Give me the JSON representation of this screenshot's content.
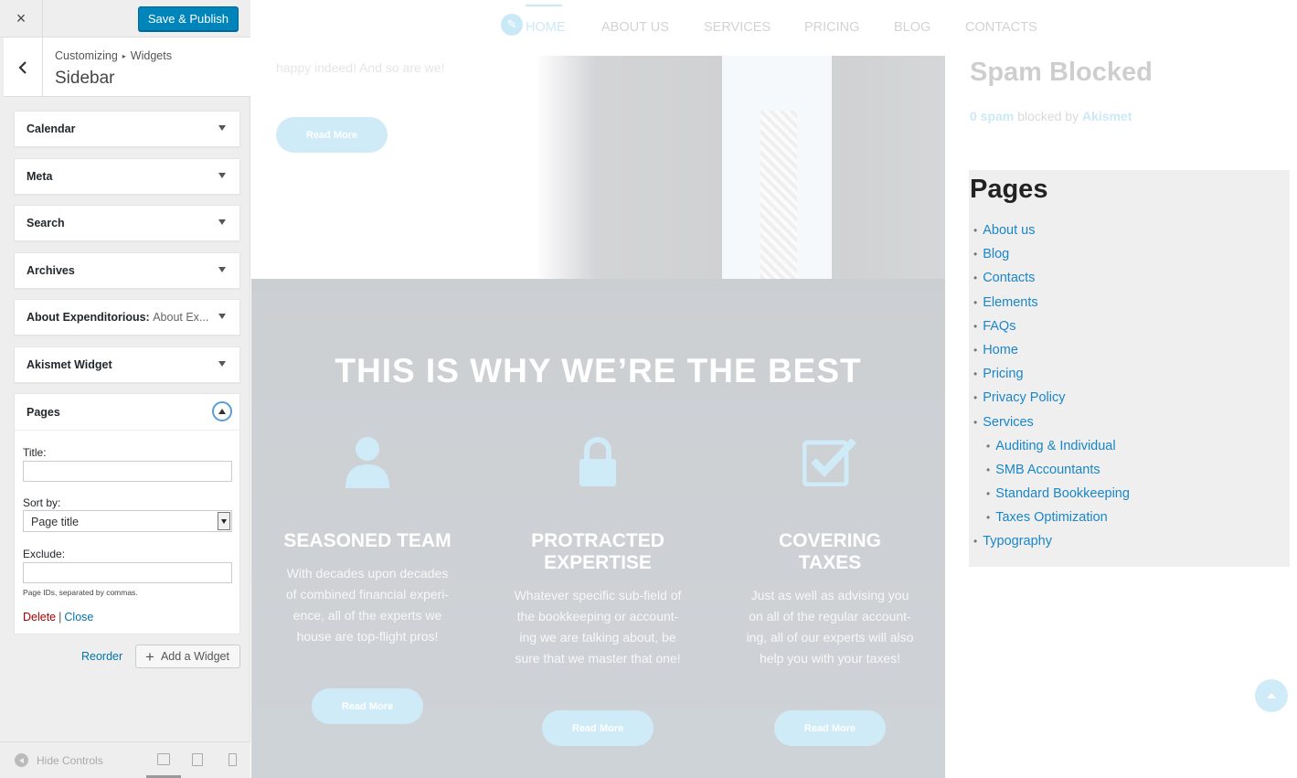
{
  "customizer": {
    "close_glyph": "×",
    "save_label": "Save & Publish",
    "breadcrumb": [
      "Customizing",
      "Widgets"
    ],
    "breadcrumb_sep": "▸",
    "section_title": "Sidebar",
    "widgets": [
      {
        "title": "Calendar",
        "sub": ""
      },
      {
        "title": "Meta",
        "sub": ""
      },
      {
        "title": "Search",
        "sub": ""
      },
      {
        "title": "Archives",
        "sub": ""
      },
      {
        "title": "About Expenditorious:",
        "sub": "About Ex..."
      },
      {
        "title": "Akismet Widget",
        "sub": ""
      }
    ],
    "open_widget": {
      "title": "Pages",
      "title_label": "Title:",
      "title_value": "",
      "sort_label": "Sort by:",
      "sort_value": "Page title",
      "exclude_label": "Exclude:",
      "exclude_value": "",
      "help": "Page IDs, separated by commas.",
      "delete": "Delete",
      "separator": "|",
      "close": "Close"
    },
    "reorder": "Reorder",
    "add_widget": "Add a Widget",
    "hide_controls": "Hide Controls"
  },
  "preview": {
    "nav": [
      "HOME",
      "ABOUT US",
      "SERVICES",
      "PRICING",
      "BLOG",
      "CONTACTS"
    ],
    "hero_text": "happy indeed! And so are we!",
    "read_more": "Read More",
    "best_title": "THIS IS WHY WE’RE THE BEST",
    "features": [
      {
        "title_lines": [
          "SEASONED TEAM"
        ],
        "text": [
          "With decades upon decades",
          "of combined financial experi-",
          "ence, all of the experts we",
          "house are top-flight pros!"
        ]
      },
      {
        "title_lines": [
          "PROTRACTED",
          "EXPERTISE"
        ],
        "text": [
          "Whatever specific sub-field of",
          "the bookkeeping or account-",
          "ing we are talking about, be",
          "sure that we master that one!"
        ]
      },
      {
        "title_lines": [
          "COVERING",
          "TAXES"
        ],
        "text": [
          "Just as well as advising you",
          "on all of the regular account-",
          "ing, all of our experts will also",
          "help you with your taxes!"
        ]
      }
    ],
    "spam": {
      "title": "Spam Blocked",
      "count": "0 spam",
      "mid": " blocked by ",
      "brand": "Akismet"
    },
    "pages_title": "Pages",
    "pages": [
      {
        "label": "About us",
        "child": false
      },
      {
        "label": "Blog",
        "child": false
      },
      {
        "label": "Contacts",
        "child": false
      },
      {
        "label": "Elements",
        "child": false
      },
      {
        "label": "FAQs",
        "child": false
      },
      {
        "label": "Home",
        "child": false
      },
      {
        "label": "Pricing",
        "child": false
      },
      {
        "label": "Privacy Policy",
        "child": false
      },
      {
        "label": "Services",
        "child": false
      },
      {
        "label": "Auditing & Individual",
        "child": true
      },
      {
        "label": "SMB Accountants",
        "child": true
      },
      {
        "label": "Standard Bookkeeping",
        "child": true
      },
      {
        "label": "Taxes Optimization",
        "child": true
      },
      {
        "label": "Typography",
        "child": false
      }
    ]
  },
  "colors": {
    "accent": "#0085ba",
    "link": "#0073aa",
    "brand_blue": "#0e9bd8",
    "delete": "#a00"
  },
  "icons": [
    "close-icon",
    "back-icon",
    "chevron-down-icon",
    "chevron-up-icon",
    "plus-icon",
    "user-icon",
    "lock-icon",
    "checkbox-icon",
    "pencil-icon",
    "arrow-up-icon",
    "desktop-icon",
    "tablet-icon",
    "mobile-icon"
  ]
}
